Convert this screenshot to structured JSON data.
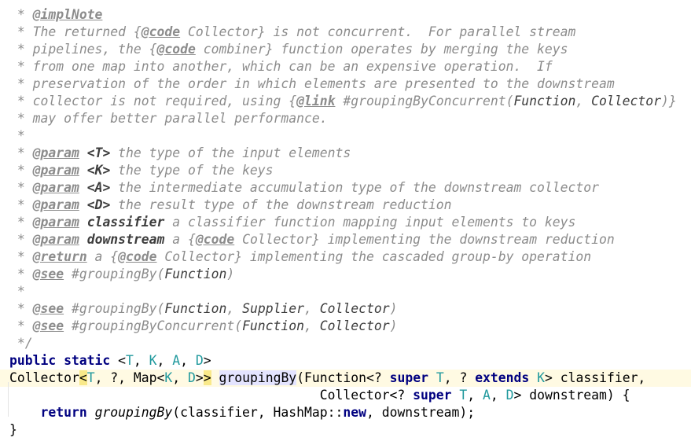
{
  "doc_lines": [
    {
      "star": " * ",
      "parts": [
        {
          "t": "@implNote",
          "c": "tagname"
        }
      ]
    },
    {
      "star": " * ",
      "parts": [
        {
          "t": "The returned {",
          "c": "doc"
        },
        {
          "t": "@code",
          "c": "tagname"
        },
        {
          "t": " Collector} is not concurrent.  For parallel stream",
          "c": "doc"
        }
      ]
    },
    {
      "star": " * ",
      "parts": [
        {
          "t": "pipelines, the {",
          "c": "doc"
        },
        {
          "t": "@code",
          "c": "tagname"
        },
        {
          "t": " combiner} function operates by merging the keys",
          "c": "doc"
        }
      ]
    },
    {
      "star": " * ",
      "parts": [
        {
          "t": "from one map into another, which can be an expensive operation.  If",
          "c": "doc"
        }
      ]
    },
    {
      "star": " * ",
      "parts": [
        {
          "t": "preservation of the order in which elements are presented to the downstream",
          "c": "doc"
        }
      ]
    },
    {
      "star": " * ",
      "parts": [
        {
          "t": "collector is not required, using {",
          "c": "doc"
        },
        {
          "t": "@link",
          "c": "tagname"
        },
        {
          "t": " #groupingByConcurrent(",
          "c": "doc"
        },
        {
          "t": "Function",
          "c": "ref"
        },
        {
          "t": ", ",
          "c": "doc"
        },
        {
          "t": "Collector",
          "c": "ref"
        },
        {
          "t": ")}",
          "c": "doc"
        }
      ]
    },
    {
      "star": " * ",
      "parts": [
        {
          "t": "may offer better parallel performance.",
          "c": "doc"
        }
      ]
    },
    {
      "star": " *",
      "parts": []
    },
    {
      "star": " * ",
      "parts": [
        {
          "t": "@param",
          "c": "tagname"
        },
        {
          "t": " ",
          "c": "doc"
        },
        {
          "t": "<T>",
          "c": "param"
        },
        {
          "t": " the type of the input elements",
          "c": "doc"
        }
      ]
    },
    {
      "star": " * ",
      "parts": [
        {
          "t": "@param",
          "c": "tagname"
        },
        {
          "t": " ",
          "c": "doc"
        },
        {
          "t": "<K>",
          "c": "param"
        },
        {
          "t": " the type of the keys",
          "c": "doc"
        }
      ]
    },
    {
      "star": " * ",
      "parts": [
        {
          "t": "@param",
          "c": "tagname"
        },
        {
          "t": " ",
          "c": "doc"
        },
        {
          "t": "<A>",
          "c": "param"
        },
        {
          "t": " the intermediate accumulation type of the downstream collector",
          "c": "doc"
        }
      ]
    },
    {
      "star": " * ",
      "parts": [
        {
          "t": "@param",
          "c": "tagname"
        },
        {
          "t": " ",
          "c": "doc"
        },
        {
          "t": "<D>",
          "c": "param"
        },
        {
          "t": " the result type of the downstream reduction",
          "c": "doc"
        }
      ]
    },
    {
      "star": " * ",
      "parts": [
        {
          "t": "@param",
          "c": "tagname"
        },
        {
          "t": " ",
          "c": "doc"
        },
        {
          "t": "classifier",
          "c": "param"
        },
        {
          "t": " a classifier function mapping input elements to keys",
          "c": "doc"
        }
      ]
    },
    {
      "star": " * ",
      "parts": [
        {
          "t": "@param",
          "c": "tagname"
        },
        {
          "t": " ",
          "c": "doc"
        },
        {
          "t": "downstream",
          "c": "param"
        },
        {
          "t": " a {",
          "c": "doc"
        },
        {
          "t": "@code",
          "c": "tagname"
        },
        {
          "t": " Collector} implementing the downstream reduction",
          "c": "doc"
        }
      ]
    },
    {
      "star": " * ",
      "parts": [
        {
          "t": "@return",
          "c": "tagname"
        },
        {
          "t": " a {",
          "c": "doc"
        },
        {
          "t": "@code",
          "c": "tagname"
        },
        {
          "t": " Collector} implementing the cascaded group-by operation",
          "c": "doc"
        }
      ]
    },
    {
      "star": " * ",
      "parts": [
        {
          "t": "@see",
          "c": "tagname"
        },
        {
          "t": " #groupingBy(",
          "c": "doc"
        },
        {
          "t": "Function",
          "c": "ref"
        },
        {
          "t": ")",
          "c": "doc"
        }
      ]
    },
    {
      "star": " *",
      "parts": []
    },
    {
      "star": " * ",
      "parts": [
        {
          "t": "@see",
          "c": "tagname"
        },
        {
          "t": " #groupingBy(",
          "c": "doc"
        },
        {
          "t": "Function",
          "c": "ref"
        },
        {
          "t": ", ",
          "c": "doc"
        },
        {
          "t": "Supplier",
          "c": "ref"
        },
        {
          "t": ", ",
          "c": "doc"
        },
        {
          "t": "Collector",
          "c": "ref"
        },
        {
          "t": ")",
          "c": "doc"
        }
      ]
    },
    {
      "star": " * ",
      "parts": [
        {
          "t": "@see",
          "c": "tagname"
        },
        {
          "t": " #groupingByConcurrent(",
          "c": "doc"
        },
        {
          "t": "Function",
          "c": "ref"
        },
        {
          "t": ", ",
          "c": "doc"
        },
        {
          "t": "Collector",
          "c": "ref"
        },
        {
          "t": ")",
          "c": "doc"
        }
      ]
    },
    {
      "star": " */",
      "parts": []
    }
  ],
  "code_lines": [
    {
      "highlight": false,
      "parts": [
        {
          "t": "public static ",
          "c": "kw"
        },
        {
          "t": "<",
          "c": "plain"
        },
        {
          "t": "T",
          "c": "tp"
        },
        {
          "t": ", ",
          "c": "plain"
        },
        {
          "t": "K",
          "c": "tp"
        },
        {
          "t": ", ",
          "c": "plain"
        },
        {
          "t": "A",
          "c": "tp"
        },
        {
          "t": ", ",
          "c": "plain"
        },
        {
          "t": "D",
          "c": "tp"
        },
        {
          "t": ">",
          "c": "plain"
        }
      ]
    },
    {
      "highlight": true,
      "parts": [
        {
          "t": "Collector",
          "c": "plain"
        },
        {
          "t": "<",
          "c": "plain brace-hl"
        },
        {
          "t": "T",
          "c": "tp"
        },
        {
          "t": ", ?, Map<",
          "c": "plain"
        },
        {
          "t": "K",
          "c": "tp"
        },
        {
          "t": ", ",
          "c": "plain"
        },
        {
          "t": "D",
          "c": "tp"
        },
        {
          "t": ">",
          "c": "plain"
        },
        {
          "t": ">",
          "c": "plain brace-hl"
        },
        {
          "t": " ",
          "c": "plain"
        },
        {
          "t": "groupingBy",
          "c": "plain method-hl"
        },
        {
          "t": "(Function<? ",
          "c": "plain"
        },
        {
          "t": "super ",
          "c": "kw"
        },
        {
          "t": "T",
          "c": "tp"
        },
        {
          "t": ", ? ",
          "c": "plain"
        },
        {
          "t": "extends ",
          "c": "kw"
        },
        {
          "t": "K",
          "c": "tp"
        },
        {
          "t": "> classifier,",
          "c": "plain"
        }
      ]
    },
    {
      "highlight": false,
      "parts": [
        {
          "t": "                                        Collector<? ",
          "c": "plain"
        },
        {
          "t": "super ",
          "c": "kw"
        },
        {
          "t": "T",
          "c": "tp"
        },
        {
          "t": ", ",
          "c": "plain"
        },
        {
          "t": "A",
          "c": "tp"
        },
        {
          "t": ", ",
          "c": "plain"
        },
        {
          "t": "D",
          "c": "tp"
        },
        {
          "t": "> downstream) {",
          "c": "plain"
        }
      ]
    },
    {
      "highlight": false,
      "parts": [
        {
          "t": "    ",
          "c": "plain"
        },
        {
          "t": "return ",
          "c": "kw"
        },
        {
          "t": "groupingBy",
          "c": "plain ital"
        },
        {
          "t": "(classifier, HashMap::",
          "c": "plain"
        },
        {
          "t": "new",
          "c": "kw"
        },
        {
          "t": ", downstream);",
          "c": "plain"
        }
      ]
    },
    {
      "highlight": false,
      "parts": [
        {
          "t": "}",
          "c": "plain"
        }
      ]
    }
  ]
}
